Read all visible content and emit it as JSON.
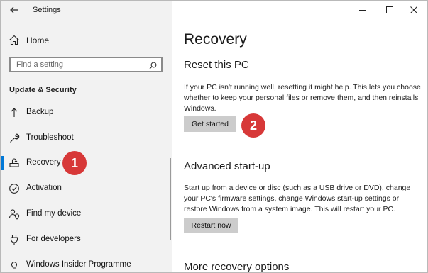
{
  "window": {
    "title": "Settings",
    "controls": [
      "minimize-icon",
      "maximize-icon",
      "close-icon"
    ]
  },
  "sidebar": {
    "home_label": "Home",
    "search_placeholder": "Find a setting",
    "section_header": "Update & Security",
    "items": [
      {
        "label": "Backup",
        "icon": "backup-arrow-icon",
        "active": false
      },
      {
        "label": "Troubleshoot",
        "icon": "wrench-icon",
        "active": false
      },
      {
        "label": "Recovery",
        "icon": "recovery-icon",
        "active": true
      },
      {
        "label": "Activation",
        "icon": "check-circle-icon",
        "active": false
      },
      {
        "label": "Find my device",
        "icon": "person-location-icon",
        "active": false
      },
      {
        "label": "For developers",
        "icon": "developer-icon",
        "active": false
      },
      {
        "label": "Windows Insider Programme",
        "icon": "insider-icon",
        "active": false
      }
    ]
  },
  "main": {
    "title": "Recovery",
    "reset": {
      "heading": "Reset this PC",
      "description": "If your PC isn't running well, resetting it might help. This lets you choose whether to keep your personal files or remove them, and then reinstalls Windows.",
      "button": "Get started"
    },
    "advanced": {
      "heading": "Advanced start-up",
      "description": "Start up from a device or disc (such as a USB drive or DVD), change your PC's firmware settings, change Windows start-up settings or restore Windows from a system image. This will restart your PC.",
      "button": "Restart now"
    },
    "more_heading": "More recovery options"
  },
  "annotations": {
    "badge1": "1",
    "badge2": "2",
    "color": "#d73838"
  },
  "colors": {
    "accent": "#0078d7",
    "sidebar_bg": "#f2f2f2",
    "button_bg": "#cccccc"
  }
}
